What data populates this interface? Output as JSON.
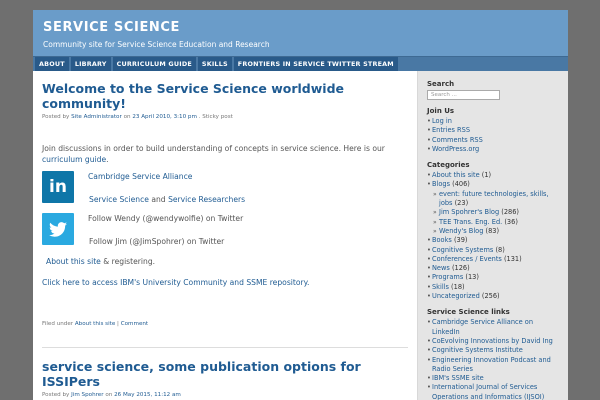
{
  "site": {
    "title": "SERVICE SCIENCE",
    "description": "Community site for Service Science Education and Research"
  },
  "nav": [
    {
      "label": "ABOUT"
    },
    {
      "label": "LIBRARY"
    },
    {
      "label": "CURRICULUM GUIDE"
    },
    {
      "label": "SKILLS"
    },
    {
      "label": "FRONTIERS IN SERVICE TWITTER STREAM"
    }
  ],
  "post1": {
    "title": "Welcome to the Service Science worldwide community!",
    "meta_prefix": "Posted by",
    "author": "Site Administrator",
    "meta_on": "on",
    "date": "23 April 2010, 3:10 pm",
    "sticky": ". Sticky post",
    "intro_text": "Join discussions  in order to build understanding of concepts in service science.  Here is our",
    "intro_link": "curriculum guide",
    "intro_end": ".",
    "cambridge_link": "Cambridge Service Alliance",
    "ss_link": "Service Science",
    "ss_and": "and",
    "sr_link": "Service Researchers",
    "follow_wendy": "Follow Wendy (@wendywolfie) on Twitter",
    "follow_jim": "Follow Jim (@JimSpohrer) on Twitter",
    "about_link": "About this site",
    "about_rest": "& registering.",
    "ibm_link": "Click here to access IBM's University Community and SSME repository.",
    "filed_prefix": "Filed under",
    "filed_cat": "About this site",
    "filed_sep": "|",
    "comment_link": "Comment"
  },
  "post2": {
    "title": "service science, some publication options for ISSIPers",
    "meta_prefix": "Posted by",
    "author": "Jim Spohrer",
    "meta_on": "on",
    "date": "26 May 2015, 11:12 am"
  },
  "sidebar": {
    "search_title": "Search",
    "search_placeholder": "Search ...",
    "joinus_title": "Join Us",
    "joinus_items": [
      "Log in",
      "Entries RSS",
      "Comments RSS",
      "WordPress.org"
    ],
    "categories_title": "Categories",
    "categories": [
      {
        "label": "About this site",
        "count": "(1)",
        "level": 0
      },
      {
        "label": "Blogs",
        "count": "(406)",
        "level": 0
      },
      {
        "label": "event: future technologies, skills,",
        "count": "",
        "level": 1
      },
      {
        "label": "jobs",
        "count": "(23)",
        "level": 2
      },
      {
        "label": "Jim Spohrer's Blog",
        "count": "(286)",
        "level": 1
      },
      {
        "label": "TEE Trans. Eng. Ed.",
        "count": "(36)",
        "level": 1
      },
      {
        "label": "Wendy's Blog",
        "count": "(83)",
        "level": 1
      },
      {
        "label": "Books",
        "count": "(39)",
        "level": 0
      },
      {
        "label": "Cognitive Systems",
        "count": "(8)",
        "level": 0
      },
      {
        "label": "Conferences / Events",
        "count": "(131)",
        "level": 0
      },
      {
        "label": "News",
        "count": "(126)",
        "level": 0
      },
      {
        "label": "Programs",
        "count": "(13)",
        "level": 0
      },
      {
        "label": "Skills",
        "count": "(18)",
        "level": 0
      },
      {
        "label": "Uncategorized",
        "count": "(256)",
        "level": 0
      }
    ],
    "links_title": "Service Science links",
    "links": [
      {
        "label": "Cambridge Service Alliance on LinkedIn",
        "cont": false
      },
      {
        "label": "CoEvolving Innovations by David Ing",
        "cont": false
      },
      {
        "label": "Cognitive Systems Institute",
        "cont": false
      },
      {
        "label": "Engineering Innovation Podcast and",
        "cont": false
      },
      {
        "label": "Radio Series",
        "cont": true
      },
      {
        "label": "IBM's SSME site",
        "cont": false
      },
      {
        "label": "International Journal of Services",
        "cont": false
      },
      {
        "label": "Operations and Informatics (IJSOI)",
        "cont": true
      }
    ]
  },
  "colors": {
    "header": "#6a9cc9",
    "navbar": "#4978a4",
    "nav_tab": "#295a89",
    "link": "#1f5b92",
    "sidebar_bg": "#e5e5e5",
    "linkedin": "#0e76a8",
    "twitter": "#2aa9e0"
  },
  "icons": {
    "linkedin": "linkedin-logo-icon",
    "twitter": "twitter-bird-icon"
  }
}
